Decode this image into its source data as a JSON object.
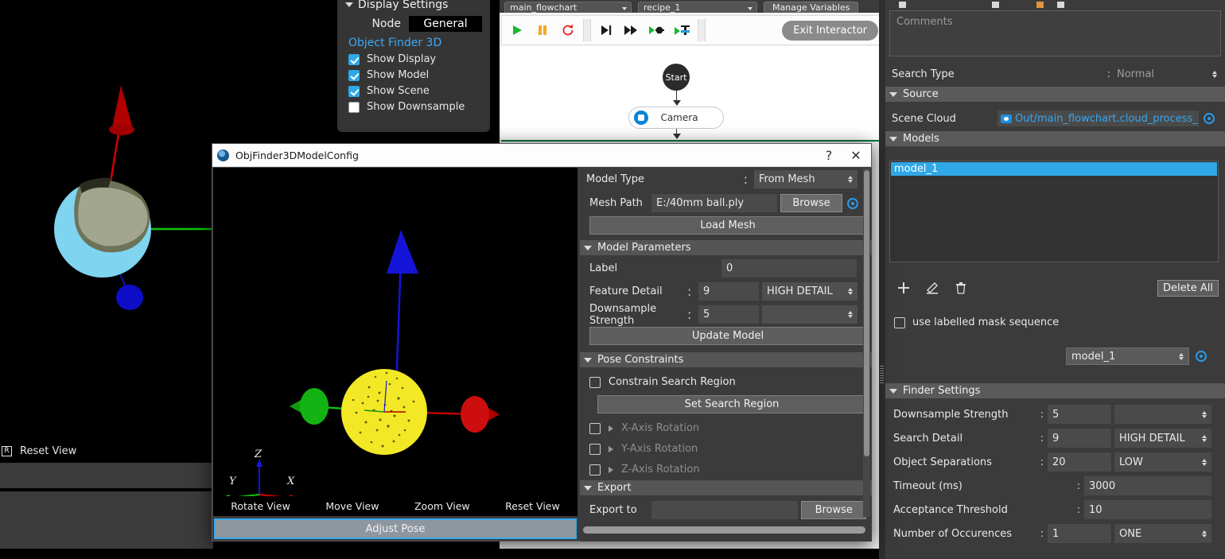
{
  "display_settings": {
    "title": "Display Settings",
    "node_label": "Node",
    "node_value": "General",
    "link": "Object Finder 3D",
    "checks": [
      {
        "label": "Show Display",
        "checked": true
      },
      {
        "label": "Show Model",
        "checked": true
      },
      {
        "label": "Show Scene",
        "checked": true
      },
      {
        "label": "Show Downsample",
        "checked": false
      }
    ]
  },
  "scene_view": {
    "reset_key": "R",
    "reset_label": "Reset View"
  },
  "top_bar": {
    "flowchart_select": "main_flowchart",
    "recipe_select": "recipe_1",
    "manage_variables": "Manage Variables"
  },
  "toolbar": {
    "play": "play-icon",
    "pause": "pause-icon",
    "reset": "reset-icon",
    "step": "step-icon",
    "fast_forward": "fast-forward-icon",
    "run_to_node": "run-to-node-icon",
    "run_to_breakpoint": "run-to-breakpoint-icon",
    "exit_interactor": "Exit Interactor"
  },
  "flowchart": {
    "start_node": "Start",
    "camera_node": "Camera"
  },
  "right_panel": {
    "comments_placeholder": "Comments",
    "search_type": {
      "label": "Search Type",
      "value": "Normal"
    },
    "source": {
      "header": "Source",
      "scene_cloud_label": "Scene Cloud",
      "scene_cloud_value": "Out/main_flowchart.cloud_process_node,"
    },
    "models": {
      "header": "Models",
      "items": [
        "model_1"
      ],
      "add": "+",
      "edit": "edit-icon",
      "delete": "trash-icon",
      "delete_all": "Delete All",
      "mask_checkbox": {
        "label": "use labelled mask sequence",
        "checked": false
      },
      "model_select": "model_1"
    },
    "finder_settings": {
      "header": "Finder Settings",
      "rows": [
        {
          "label": "Downsample Strength",
          "value": "5",
          "combo": ""
        },
        {
          "label": "Search Detail",
          "value": "9",
          "combo": "HIGH DETAIL"
        },
        {
          "label": "Object Separations",
          "value": "20",
          "combo": "LOW"
        },
        {
          "label": "Timeout (ms)",
          "value": "3000",
          "combo": null
        },
        {
          "label": "Acceptance Threshold",
          "value": "10",
          "combo": null
        },
        {
          "label": "Number of Occurences",
          "value": "1",
          "combo": "ONE"
        }
      ]
    }
  },
  "dialog": {
    "title": "ObjFinder3DModelConfig",
    "help_button": "?",
    "close_button": "✕",
    "viewport": {
      "axis_labels": {
        "x": "X",
        "y": "Y",
        "z": "Z"
      },
      "controls": [
        "Rotate View",
        "Move View",
        "Zoom View",
        "Reset View"
      ],
      "adjust_pose": "Adjust Pose"
    },
    "model_type": {
      "label": "Model Type",
      "value": "From Mesh"
    },
    "mesh_path": {
      "label": "Mesh Path",
      "value": "E:/40mm ball.ply",
      "browse": "Browse"
    },
    "load_mesh": "Load Mesh",
    "model_parameters": {
      "header": "Model Parameters",
      "label_row": {
        "label": "Label",
        "value": "0"
      },
      "feature_detail": {
        "label": "Feature Detail",
        "value": "9",
        "combo": "HIGH DETAIL"
      },
      "downsample_strength": {
        "label": "Downsample Strength",
        "value": "5",
        "combo": ""
      },
      "update_model": "Update Model"
    },
    "pose_constraints": {
      "header": "Pose Constraints",
      "constrain_search_region": {
        "label": "Constrain Search Region",
        "checked": false
      },
      "set_search_region": "Set Search Region",
      "rotations": [
        {
          "label": "X-Axis Rotation",
          "checked": false
        },
        {
          "label": "Y-Axis Rotation",
          "checked": false
        },
        {
          "label": "Z-Axis Rotation",
          "checked": false
        }
      ]
    },
    "export": {
      "header": "Export",
      "export_to_label": "Export to",
      "export_to_value": "",
      "browse": "Browse"
    }
  },
  "colors": {
    "accent_blue": "#2fa8e8",
    "link_blue": "#38a6f0",
    "panel_bg": "#3b3b3b",
    "section_bg": "#5a5a5a",
    "axis_x": "#d40000",
    "axis_y": "#00a000",
    "axis_z": "#0000d4",
    "model_yellow": "#f2e825",
    "scene_blue": "#7fd4f0"
  }
}
